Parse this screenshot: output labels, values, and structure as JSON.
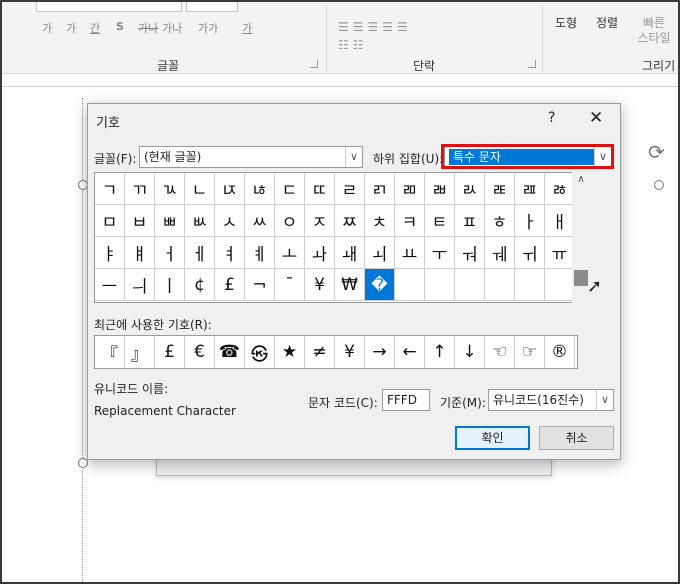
{
  "ribbon": {
    "font_format_buttons": [
      "가",
      "가",
      "간",
      "S",
      "가나",
      "가가",
      "가"
    ],
    "groups": {
      "font": "글꼴",
      "paragraph": "단락",
      "drawing": "그리기"
    },
    "buttons": {
      "shape": "도형",
      "arrange": "정렬",
      "quick_style_line1": "빠른",
      "quick_style_line2": "스타일"
    }
  },
  "dialog": {
    "title": "기호",
    "help": "?",
    "close": "✕",
    "font_label": "글꼴",
    "font_hotkey": "(F)",
    "font_value": "(현재 글꼴)",
    "subset_label": "하위 집합",
    "subset_hotkey": "(U)",
    "subset_value": "특수 문자",
    "symbols": [
      "ㄱ",
      "ㄲ",
      "ㄳ",
      "ㄴ",
      "ㄵ",
      "ㄶ",
      "ㄷ",
      "ㄸ",
      "ㄹ",
      "ㄺ",
      "ㄻ",
      "ㄼ",
      "ㄽ",
      "ㄾ",
      "ㄿ",
      "ㅀ",
      "ㅁ",
      "ㅂ",
      "ㅃ",
      "ㅄ",
      "ㅅ",
      "ㅆ",
      "ㅇ",
      "ㅈ",
      "ㅉ",
      "ㅊ",
      "ㅋ",
      "ㅌ",
      "ㅍ",
      "ㅎ",
      "ㅏ",
      "ㅐ",
      "ㅑ",
      "ㅒ",
      "ㅓ",
      "ㅔ",
      "ㅕ",
      "ㅖ",
      "ㅗ",
      "ㅘ",
      "ㅙ",
      "ㅚ",
      "ㅛ",
      "ㅜ",
      "ㅝ",
      "ㅞ",
      "ㅟ",
      "ㅠ",
      "ㅡ",
      "ㅢ",
      "ㅣ",
      "¢",
      "£",
      "¬",
      "¯",
      "¥",
      "₩",
      "�",
      "",
      "",
      "",
      "",
      "",
      ""
    ],
    "recent_label": "최근에 사용한 기호",
    "recent_hotkey": "(R)",
    "recent_symbols": [
      "『",
      "』",
      "£",
      "€",
      "☎",
      "㉿",
      "★",
      "≠",
      "¥",
      "→",
      "←",
      "↑",
      "↓",
      "☜",
      "☞",
      "®"
    ],
    "unicode_name_label": "유니코드 이름:",
    "unicode_name_value": "Replacement Character",
    "char_code_label": "문자 코드",
    "char_code_hotkey": "(C)",
    "char_code_value": "FFFD",
    "basis_label": "기준",
    "basis_hotkey": "(M)",
    "basis_value": "유니코드(16진수)",
    "ok": "확인",
    "cancel": "취소"
  },
  "colors": {
    "selection": "#0078d7",
    "highlight_box": "#e01010"
  }
}
